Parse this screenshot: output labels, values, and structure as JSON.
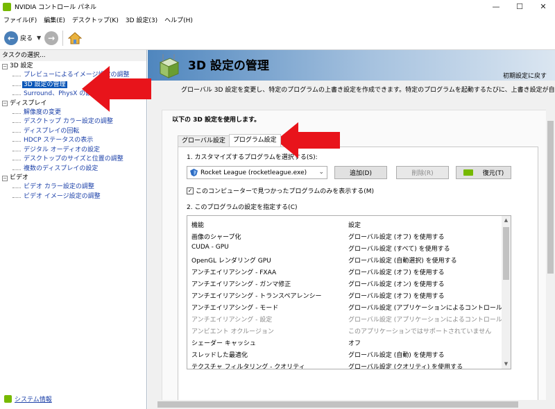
{
  "window": {
    "title": "NVIDIA コントロール パネル",
    "minimize": "—",
    "maximize": "☐",
    "close": "✕"
  },
  "menu": [
    "ファイル(F)",
    "編集(E)",
    "デスクトップ(K)",
    "3D 設定(3)",
    "ヘルプ(H)"
  ],
  "toolbar": {
    "back_label": "戻る"
  },
  "left": {
    "task_header": "タスクの選択...",
    "categories": [
      {
        "label": "3D 設定",
        "toggle": "−",
        "items": [
          "プレビューによるイメージ設定の調整",
          "3D 設定の管理",
          "Surround、PhysX の設定"
        ]
      },
      {
        "label": "ディスプレイ",
        "toggle": "−",
        "items": [
          "解像度の変更",
          "デスクトップ カラー設定の調整",
          "ディスプレイの回転",
          "HDCP ステータスの表示",
          "デジタル オーディオの設定",
          "デスクトップのサイズと位置の調整",
          "複数のディスプレイの設定"
        ]
      },
      {
        "label": "ビデオ",
        "toggle": "−",
        "items": [
          "ビデオ カラー設定の調整",
          "ビデオ イメージ設定の調整"
        ]
      }
    ],
    "system_info": "システム情報"
  },
  "main": {
    "title": "3D 設定の管理",
    "restore_defaults": "初期設定に戻す",
    "description": "グローバル 3D 設定を変更し、特定のプログラムの上書き設定を作成できます。特定のプログラムを起動するたびに、上書き設定が自動",
    "section_label": "以下の 3D 設定を使用します。",
    "tabs": [
      "グローバル設定",
      "プログラム設定"
    ],
    "step1": "1. カスタマイズするプログラムを選択する(S):",
    "program_select": "Rocket League (rocketleague.exe)",
    "btn_add": "追加(D)",
    "btn_delete": "削除(R)",
    "btn_restore": "復元(T)",
    "checkbox_label": "このコンピューターで見つかったプログラムのみを表示する(M)",
    "checkbox_checked": "✓",
    "step2": "2. このプログラムの設定を指定する(C)",
    "table": {
      "headers": [
        "機能",
        "設定"
      ],
      "rows": [
        {
          "feature": "画像のシャープ化",
          "setting": "グローバル設定 (オフ) を使用する",
          "dim": false
        },
        {
          "feature": "CUDA - GPU",
          "setting": "グローバル設定 (すべて) を使用する",
          "dim": false
        },
        {
          "feature": "OpenGL レンダリング GPU",
          "setting": "グローバル設定 (自動選択) を使用する",
          "dim": false
        },
        {
          "feature": "アンチエイリアシング - FXAA",
          "setting": "グローバル設定 (オフ) を使用する",
          "dim": false
        },
        {
          "feature": "アンチエイリアシング - ガンマ修正",
          "setting": "グローバル設定 (オン) を使用する",
          "dim": false
        },
        {
          "feature": "アンチエイリアシング - トランスペアレンシー",
          "setting": "グローバル設定 (オフ) を使用する",
          "dim": false
        },
        {
          "feature": "アンチエイリアシング - モード",
          "setting": "グローバル設定 (アプリケーションによるコントロール) を...",
          "dim": false
        },
        {
          "feature": "アンチエイリアシング - 設定",
          "setting": "グローバル設定 (アプリケーションによるコントロール) を...",
          "dim": true
        },
        {
          "feature": "アンビエント オクルージョン",
          "setting": "このアプリケーションではサポートされていません",
          "dim": true
        },
        {
          "feature": "シェーダー キャッシュ",
          "setting": "オフ",
          "dim": false
        },
        {
          "feature": "スレッドした最適化",
          "setting": "グローバル設定 (自動) を使用する",
          "dim": false
        },
        {
          "feature": "テクスチャ フィルタリング - クオリティ",
          "setting": "グローバル設定 (クオリティ) を使用する",
          "dim": false
        }
      ]
    }
  },
  "colors": {
    "accent_green": "#76b900",
    "link_blue": "#1a3fa8",
    "selection_blue": "#0a56b8",
    "annotation_red": "#e8141b"
  }
}
